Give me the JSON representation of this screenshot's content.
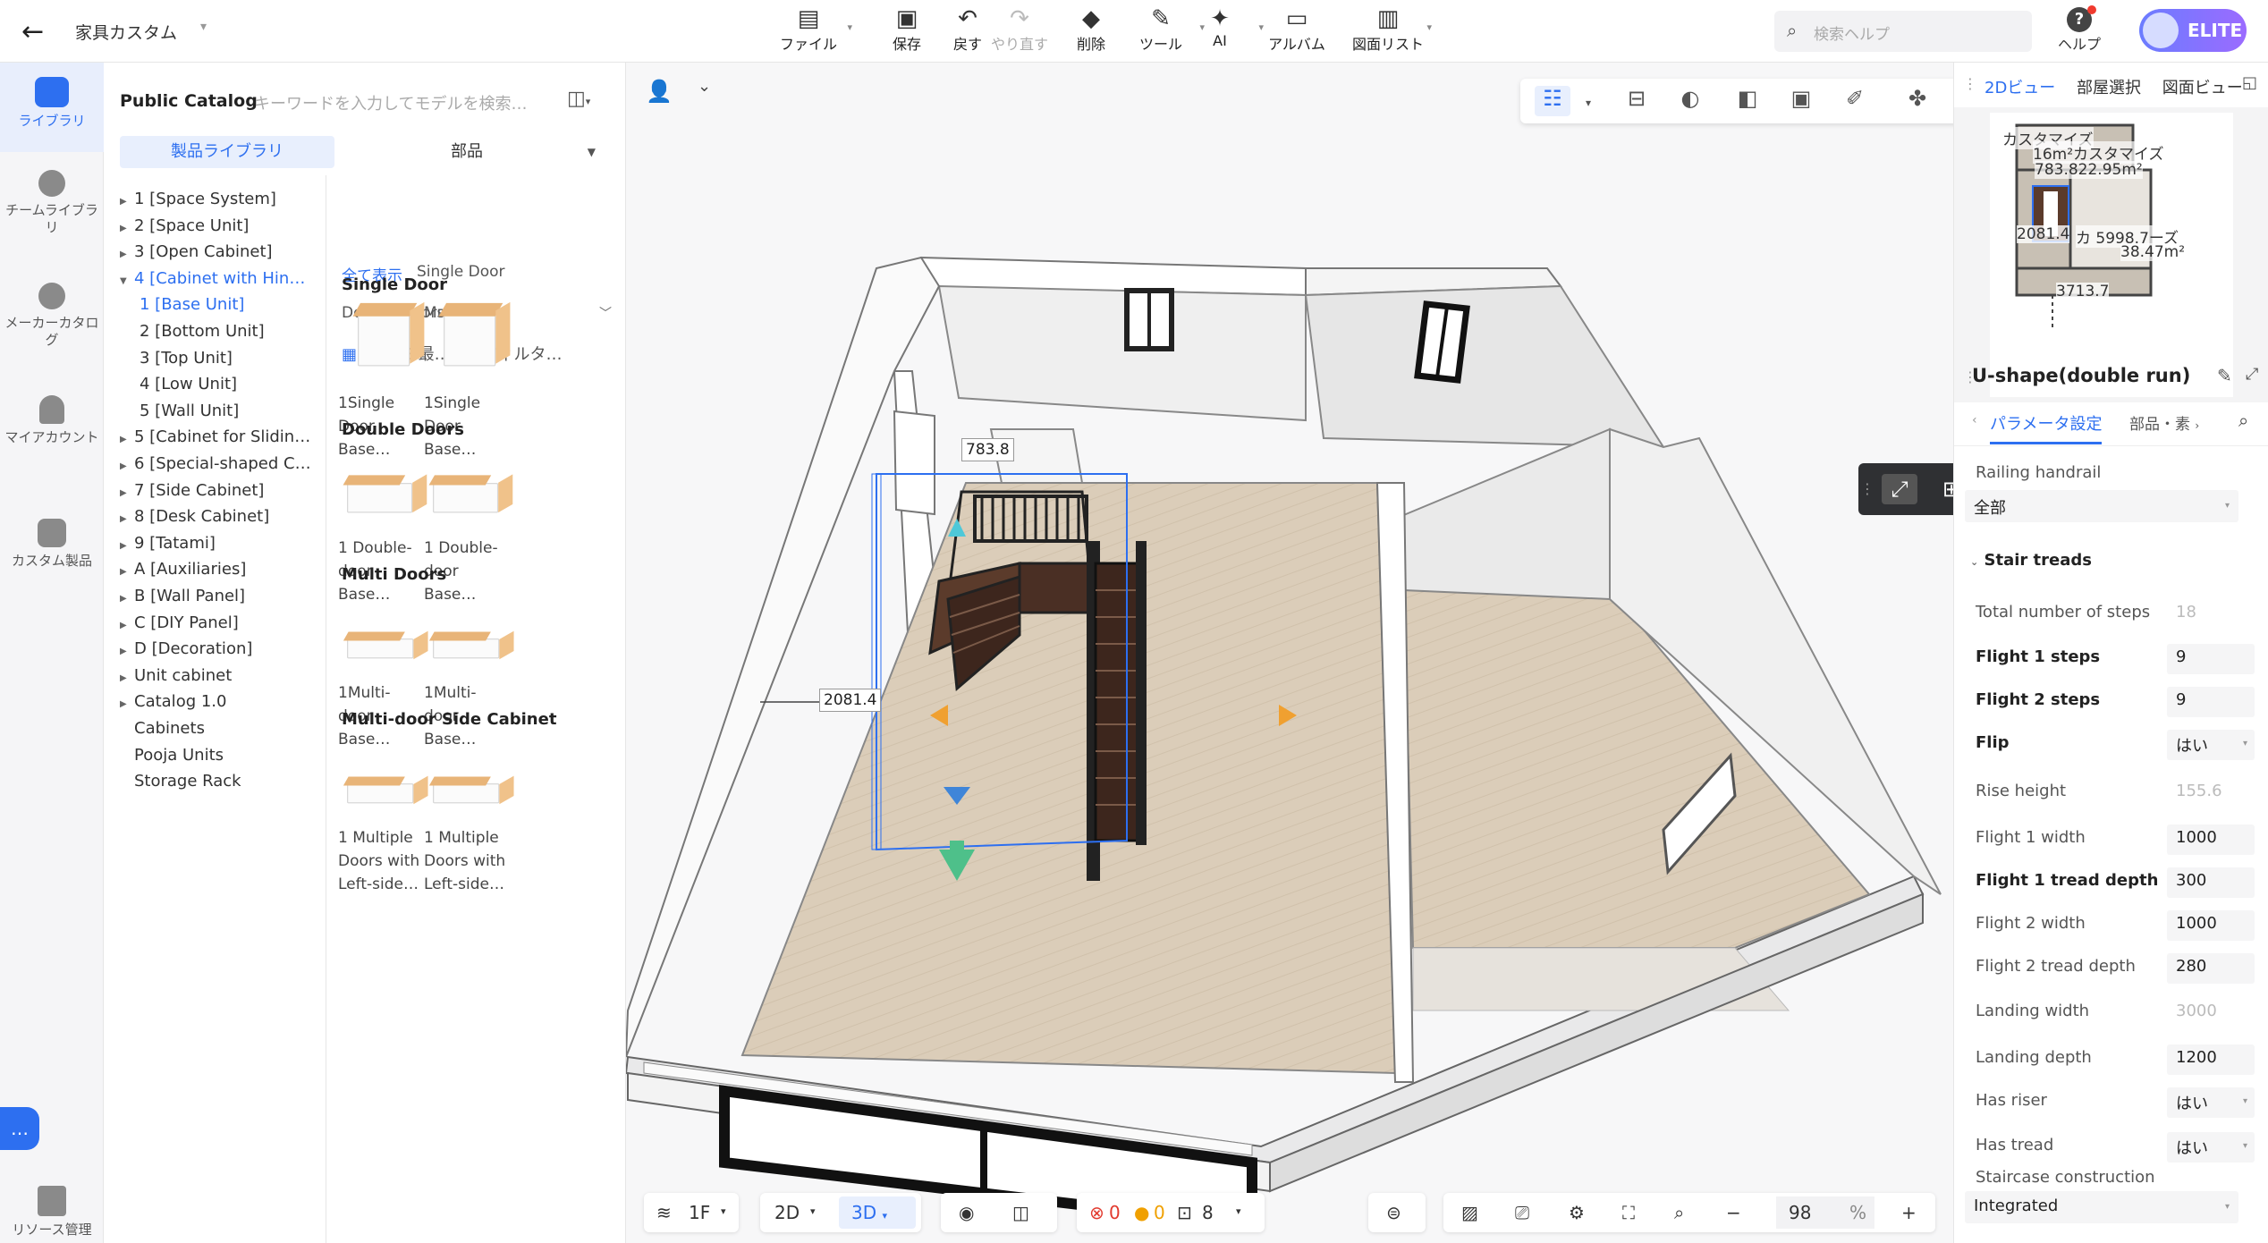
{
  "topbar": {
    "project_name": "家具カスタム",
    "tools": [
      {
        "label": "ファイル",
        "icon": "file-icon",
        "glyph": "▤"
      },
      {
        "label": "保存",
        "icon": "save-icon",
        "glyph": "▣"
      },
      {
        "label": "戻す",
        "icon": "undo-icon",
        "glyph": "↶"
      },
      {
        "label": "やり直す",
        "icon": "redo-icon",
        "glyph": "↷"
      },
      {
        "label": "削除",
        "icon": "eraser-icon",
        "glyph": "◆"
      },
      {
        "label": "ツール",
        "icon": "wrench-icon",
        "glyph": "✎"
      },
      {
        "label": "AI",
        "icon": "ai-icon",
        "glyph": "✦"
      },
      {
        "label": "アルバム",
        "icon": "album-icon",
        "glyph": "▭"
      },
      {
        "label": "図面リスト",
        "icon": "drawing-list-icon",
        "glyph": "▥"
      }
    ],
    "search_placeholder": "検索ヘルプ",
    "help_label": "ヘルプ",
    "badge": "ELITE"
  },
  "rail": {
    "items": [
      "ライブラリ",
      "チームライブラリ",
      "メーカーカタログ",
      "マイアカウント",
      "カスタム製品",
      "リソース管理"
    ]
  },
  "catalog": {
    "title": "Public Catalog",
    "search_placeholder": "キーワードを入力してモデルを検索…",
    "tab_library": "製品ライブラリ",
    "tab_parts": "部品",
    "tree": [
      "1 [Space System]",
      "2 [Space Unit]",
      "3 [Open Cabinet]",
      "4 [Cabinet with Hin…",
      "1 [Base Unit]",
      "2 [Bottom Unit]",
      "3 [Top Unit]",
      "4 [Low Unit]",
      "5 [Wall Unit]",
      "5 [Cabinet for Slidin…",
      "6 [Special-shaped C…",
      "7 [Side Cabinet]",
      "8 [Desk Cabinet]",
      "9 [Tatami]",
      "A [Auxiliaries]",
      "B [Wall Panel]",
      "C [DIY Panel]",
      "D [Decoration]",
      "Unit cabinet",
      "Catalog 1.0",
      "Cabinets",
      "Pooja Units",
      "Storage Rack"
    ],
    "filter_all": "全て表示",
    "filters_row1": [
      "Single Door"
    ],
    "filters_row2": [
      "Double Doors",
      "Multi Doors"
    ],
    "sort_label": "最…",
    "filter_label": "フィルタ…",
    "sections": [
      {
        "title": "Single Door",
        "items": [
          "1Single Door Base…",
          "1Single Door Base…"
        ]
      },
      {
        "title": "Double Doors",
        "items": [
          "1 Double-door Base…",
          "1 Double-door Base…"
        ]
      },
      {
        "title": "Multi Doors",
        "items": [
          "1Multi-door Base…",
          "1Multi-door Base…"
        ]
      },
      {
        "title": "Multi-door Side Cabinet",
        "items": [
          "1 Multiple Doors with Left-side…",
          "1 Multiple Doors with Left-side…"
        ]
      }
    ]
  },
  "canvas": {
    "dim_top": "783.8",
    "dim_left": "2081.4"
  },
  "bottombar": {
    "floor": "1F",
    "view2d": "2D",
    "view3d": "3D",
    "errors": "0",
    "warnings": "0",
    "rooms": "8",
    "zoom": "98",
    "zoom_unit": "%"
  },
  "right": {
    "view_tabs": [
      "2Dビュー",
      "部屋選択",
      "図面ビュー"
    ],
    "minimap_labels": [
      "カスタマイズ",
      "16m²カスタマイズ",
      "783.822.95m²",
      "2081.4",
      "カ 5998.7ーズ",
      "38.47m²",
      "3713.7"
    ],
    "title": "U-shape(double run)",
    "tab_params": "パラメータ設定",
    "tab_parts": "部品・素",
    "railing_label": "Railing handrail",
    "railing_value": "全部",
    "treads_section": "Stair treads",
    "params": [
      {
        "label": "Total number of steps",
        "value": "18",
        "bold": false,
        "disabled": true,
        "dropdown": false
      },
      {
        "label": "Flight 1 steps",
        "value": "9",
        "bold": true,
        "disabled": false,
        "dropdown": false
      },
      {
        "label": "Flight 2 steps",
        "value": "9",
        "bold": true,
        "disabled": false,
        "dropdown": false
      },
      {
        "label": "Flip",
        "value": "はい",
        "bold": true,
        "disabled": false,
        "dropdown": true
      },
      {
        "label": "Rise height",
        "value": "155.6",
        "bold": false,
        "disabled": true,
        "dropdown": false
      },
      {
        "label": "Flight 1 width",
        "value": "1000",
        "bold": false,
        "disabled": false,
        "dropdown": false
      },
      {
        "label": "Flight 1 tread depth",
        "value": "300",
        "bold": true,
        "disabled": false,
        "dropdown": false
      },
      {
        "label": "Flight 2 width",
        "value": "1000",
        "bold": false,
        "disabled": false,
        "dropdown": false
      },
      {
        "label": "Flight 2 tread depth",
        "value": "280",
        "bold": false,
        "disabled": false,
        "dropdown": false
      },
      {
        "label": "Landing width",
        "value": "3000",
        "bold": false,
        "disabled": true,
        "dropdown": false
      },
      {
        "label": "Landing depth",
        "value": "1200",
        "bold": false,
        "disabled": false,
        "dropdown": false
      },
      {
        "label": "Has riser",
        "value": "はい",
        "bold": false,
        "disabled": false,
        "dropdown": true
      },
      {
        "label": "Has tread",
        "value": "はい",
        "bold": false,
        "disabled": false,
        "dropdown": true
      }
    ],
    "construction_label": "Staircase construction",
    "construction_value": "Integrated"
  },
  "colors": {
    "accent": "#2d6ff0",
    "floor": "#d9cbb8",
    "stair": "#4a2f24"
  }
}
